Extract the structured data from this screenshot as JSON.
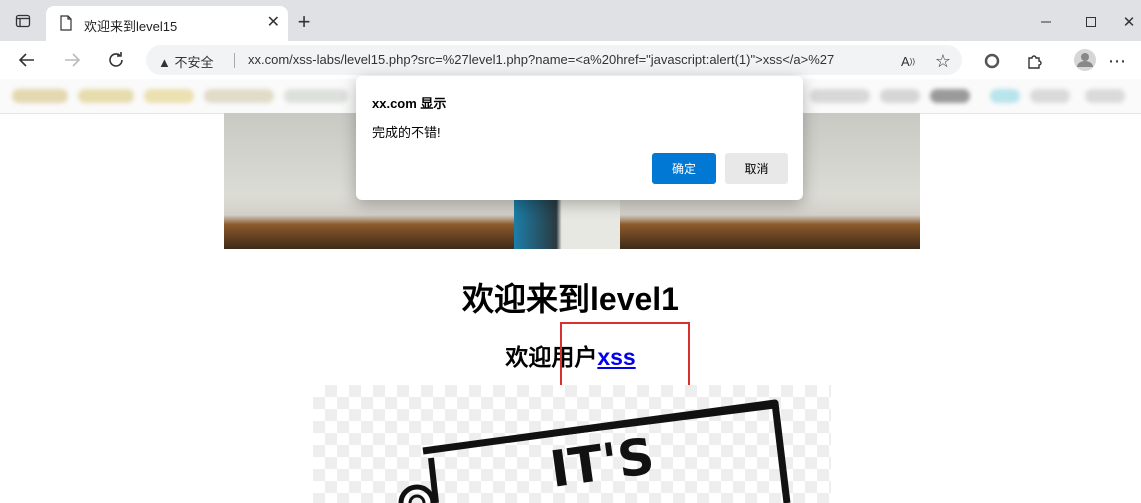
{
  "browser": {
    "tab_title": "欢迎来到level15",
    "security_label": "不安全",
    "url": "xx.com/xss-labs/level15.php?src=%27level1.php?name=<a%20href=\"javascript:alert(1)\">xss</a>%27",
    "icons": [
      "tab-actions-icon",
      "page-icon",
      "close-icon",
      "new-tab-icon",
      "minimize-icon",
      "maximize-icon",
      "window-close-icon",
      "back-icon",
      "forward-icon",
      "refresh-icon",
      "warning-icon",
      "read-aloud-icon",
      "favorites-icon",
      "collections-icon",
      "extensions-icon",
      "profile-icon",
      "more-icon"
    ]
  },
  "page": {
    "heading": "欢迎来到level1",
    "subheading_prefix": "欢迎用户",
    "user_link": "xss"
  },
  "dialog": {
    "title": "xx.com 显示",
    "message": "完成的不错!",
    "ok_label": "确定",
    "cancel_label": "取消"
  },
  "colors": {
    "accent": "#0078d4",
    "link": "#0000ee",
    "highlight_box": "#d83030"
  }
}
